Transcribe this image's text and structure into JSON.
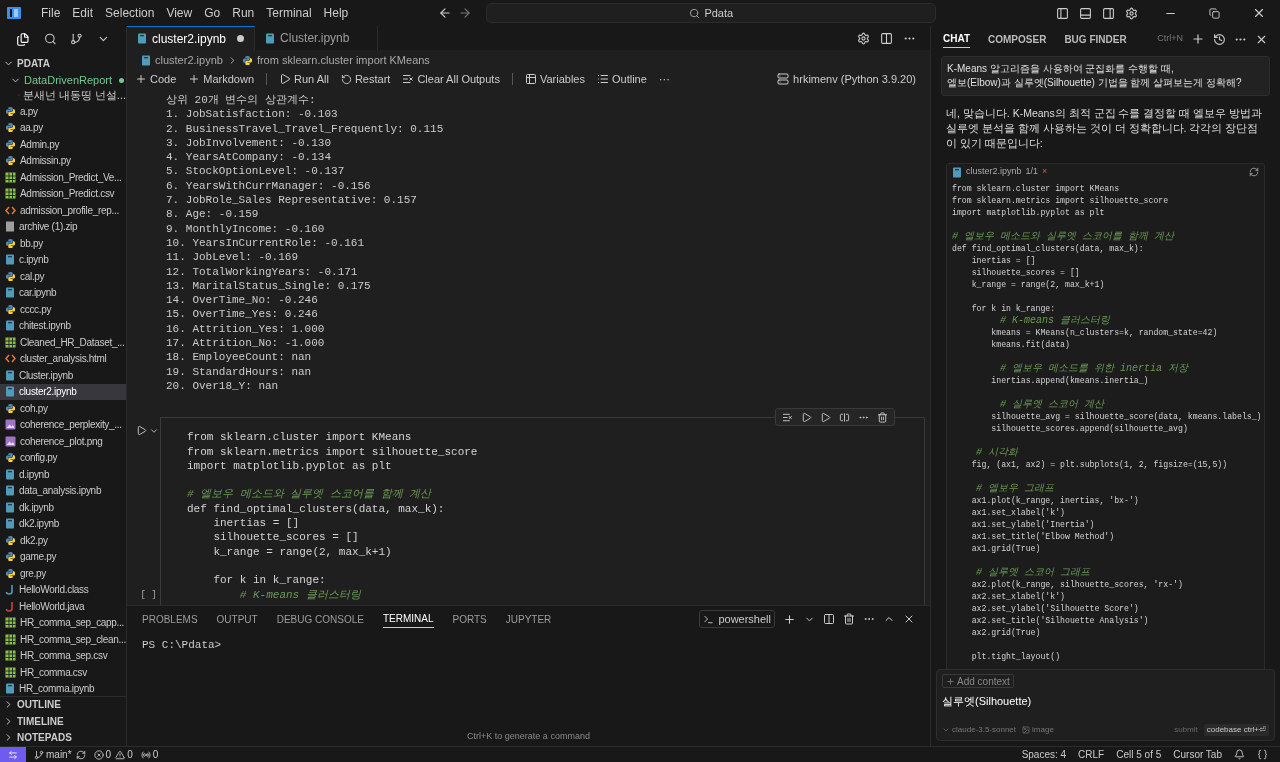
{
  "menu": [
    "File",
    "Edit",
    "Selection",
    "View",
    "Go",
    "Run",
    "Terminal",
    "Help"
  ],
  "search": {
    "value": "Pdata"
  },
  "explorer": {
    "title": "PDATA",
    "folder": {
      "label": "DataDrivenReport",
      "expanded": true,
      "child": "분새넌 내동띵 넌설..."
    },
    "files": [
      {
        "name": "a.py",
        "kind": "py",
        "selected": false
      },
      {
        "name": "aa.py",
        "kind": "py",
        "selected": false
      },
      {
        "name": "Admin.py",
        "kind": "py",
        "selected": false
      },
      {
        "name": "Admissin.py",
        "kind": "py",
        "selected": false
      },
      {
        "name": "Admission_Predict_Ve...",
        "kind": "csv",
        "selected": false
      },
      {
        "name": "Admission_Predict.csv",
        "kind": "csv",
        "selected": false
      },
      {
        "name": "admission_profile_rep...",
        "kind": "html",
        "selected": false
      },
      {
        "name": "archive (1).zip",
        "kind": "zip",
        "selected": false
      },
      {
        "name": "bb.py",
        "kind": "py",
        "selected": false
      },
      {
        "name": "c.ipynb",
        "kind": "ipynb",
        "selected": false
      },
      {
        "name": "cal.py",
        "kind": "py",
        "selected": false
      },
      {
        "name": "car.ipynb",
        "kind": "ipynb",
        "selected": false
      },
      {
        "name": "cccc.py",
        "kind": "py",
        "selected": false
      },
      {
        "name": "chitest.ipynb",
        "kind": "ipynb",
        "selected": false
      },
      {
        "name": "Cleaned_HR_Dataset_...",
        "kind": "csv",
        "selected": false
      },
      {
        "name": "cluster_analysis.html",
        "kind": "html",
        "selected": false
      },
      {
        "name": "Cluster.ipynb",
        "kind": "ipynb",
        "selected": false
      },
      {
        "name": "cluster2.ipynb",
        "kind": "ipynb",
        "selected": true
      },
      {
        "name": "coh.py",
        "kind": "py",
        "selected": false
      },
      {
        "name": "coherence_perplexity_...",
        "kind": "png",
        "selected": false
      },
      {
        "name": "coherence_plot.png",
        "kind": "png",
        "selected": false
      },
      {
        "name": "config.py",
        "kind": "py",
        "selected": false
      },
      {
        "name": "d.ipynb",
        "kind": "ipynb",
        "selected": false
      },
      {
        "name": "data_analysis.ipynb",
        "kind": "ipynb",
        "selected": false
      },
      {
        "name": "dk.ipynb",
        "kind": "ipynb",
        "selected": false
      },
      {
        "name": "dk2.ipynb",
        "kind": "ipynb",
        "selected": false
      },
      {
        "name": "dk2.py",
        "kind": "py",
        "selected": false
      },
      {
        "name": "game.py",
        "kind": "py",
        "selected": false
      },
      {
        "name": "gre.py",
        "kind": "py",
        "selected": false
      },
      {
        "name": "HelloWorld.class",
        "kind": "class",
        "selected": false
      },
      {
        "name": "HelloWorld.java",
        "kind": "java",
        "selected": false
      },
      {
        "name": "HR_comma_sep_capp...",
        "kind": "csv",
        "selected": false
      },
      {
        "name": "HR_comma_sep_clean...",
        "kind": "csv",
        "selected": false
      },
      {
        "name": "HR_comma_sep.csv",
        "kind": "csv",
        "selected": false
      },
      {
        "name": "HR_comma.csv",
        "kind": "csv",
        "selected": false
      },
      {
        "name": "HR_comma.ipynb",
        "kind": "ipynb",
        "selected": false
      }
    ],
    "sections": [
      "OUTLINE",
      "TIMELINE",
      "NOTEPADS"
    ]
  },
  "tabs": [
    {
      "label": "cluster2.ipynb",
      "selected": true,
      "dirty": true
    },
    {
      "label": "Cluster.ipynb",
      "selected": false,
      "dirty": false
    }
  ],
  "breadcrumb": [
    "cluster2.ipynb",
    "from sklearn.cluster import KMeans"
  ],
  "toolbar": {
    "left": [
      "Code",
      "Markdown"
    ],
    "run": [
      "Run All",
      "Restart",
      "Clear All Outputs"
    ],
    "views": [
      "Variables",
      "Outline"
    ],
    "more": "···",
    "kernel": "hrkimenv (Python 3.9.20)"
  },
  "output": [
    "상위 20개 변수의 상관계수:",
    "1. JobSatisfaction: -0.103",
    "2. BusinessTravel_Travel_Frequently: 0.115",
    "3. JobInvolvement: -0.130",
    "4. YearsAtCompany: -0.134",
    "5. StockOptionLevel: -0.137",
    "6. YearsWithCurrManager: -0.156",
    "7. JobRole_Sales Representative: 0.157",
    "8. Age: -0.159",
    "9. MonthlyIncome: -0.160",
    "10. YearsInCurrentRole: -0.161",
    "11. JobLevel: -0.169",
    "12. TotalWorkingYears: -0.171",
    "13. MaritalStatus_Single: 0.175",
    "14. OverTime_No: -0.246",
    "15. OverTime_Yes: 0.246",
    "16. Attrition_Yes: 1.000",
    "17. Attrition_No: -1.000",
    "18. EmployeeCount: nan",
    "19. StandardHours: nan",
    "20. Over18_Y: nan"
  ],
  "cell": {
    "exec": "[ ]",
    "blocks": [
      [
        {
          "text": "from sklearn.cluster import KMeans",
          "kind": "code"
        },
        {
          "text": "from sklearn.metrics import silhouette_score",
          "kind": "code"
        },
        {
          "text": "import matplotlib.pyplot as plt",
          "kind": "code"
        }
      ],
      [
        {
          "text": "# 엘보우 메소드와 실루엣 스코어를 함께 계산",
          "kind": "comment"
        },
        {
          "text": "def find_optimal_clusters(data, max_k):",
          "kind": "code"
        },
        {
          "text": "    inertias = []",
          "kind": "code"
        },
        {
          "text": "    silhouette_scores = []",
          "kind": "code"
        },
        {
          "text": "    k_range = range(2, max_k+1)",
          "kind": "code"
        }
      ],
      [
        {
          "text": "    for k in k_range:",
          "kind": "code"
        },
        {
          "text": "        # K-means 클러스터링",
          "kind": "comment"
        }
      ]
    ]
  },
  "panel": {
    "tabs": [
      {
        "label": "PROBLEMS",
        "selected": false
      },
      {
        "label": "OUTPUT",
        "selected": false
      },
      {
        "label": "DEBUG CONSOLE",
        "selected": false
      },
      {
        "label": "TERMINAL",
        "selected": true
      },
      {
        "label": "PORTS",
        "selected": false
      },
      {
        "label": "JUPYTER",
        "selected": false
      }
    ],
    "shell": "powershell",
    "prompt": "PS C:\\Pdata>",
    "hint": "Ctrl+K to generate a command"
  },
  "chat": {
    "tabs": [
      {
        "label": "CHAT",
        "selected": true
      },
      {
        "label": "COMPOSER",
        "selected": false
      },
      {
        "label": "BUG FINDER",
        "selected": false
      }
    ],
    "shortcut": "Ctrl+N",
    "question": [
      "K-Means 알고리즘을 사용하여 군집화를 수행할 때,",
      "엘보(Elbow)과 실루엣(Silhouette) 기법을 함께 살펴보는게 정확해?"
    ],
    "answer": "네, 맞습니다. K-Means의 최적 군집 수를 결정할 때 엘보우 방법과 실루엣 분석을 함께 사용하는 것이 더 정확합니다. 각각의 장단점이 있기 때문입니다:",
    "code_file": "cluster2.ipynb",
    "code_count": "1/1",
    "code_close": "×",
    "code_blocks": [
      [
        {
          "text": "from sklearn.cluster import KMeans",
          "kind": "code"
        },
        {
          "text": "from sklearn.metrics import silhouette_score",
          "kind": "code"
        },
        {
          "text": "import matplotlib.pyplot as plt",
          "kind": "code"
        }
      ],
      [
        {
          "text": "# 엘보우 메소드와 실루엣 스코어를 함께 계산",
          "kind": "comment"
        },
        {
          "text": "def find_optimal_clusters(data, max_k):",
          "kind": "code"
        },
        {
          "text": "    inertias = []",
          "kind": "code"
        },
        {
          "text": "    silhouette_scores = []",
          "kind": "code"
        },
        {
          "text": "    k_range = range(2, max_k+1)",
          "kind": "code"
        }
      ],
      [
        {
          "text": "    for k in k_range:",
          "kind": "code"
        },
        {
          "text": "        # K-means 클러스터링",
          "kind": "comment"
        },
        {
          "text": "        kmeans = KMeans(n_clusters=k, random_state=42)",
          "kind": "code"
        },
        {
          "text": "        kmeans.fit(data)",
          "kind": "code"
        }
      ],
      [
        {
          "text": "        # 엘보우 메소드를 위한 inertia 저장",
          "kind": "comment"
        },
        {
          "text": "        inertias.append(kmeans.inertia_)",
          "kind": "code"
        }
      ],
      [
        {
          "text": "        # 실루엣 스코어 계산",
          "kind": "comment"
        },
        {
          "text": "        silhouette_avg = silhouette_score(data, kmeans.labels_)",
          "kind": "code"
        },
        {
          "text": "        silhouette_scores.append(silhouette_avg)",
          "kind": "code"
        }
      ],
      [
        {
          "text": "    # 시각화",
          "kind": "comment"
        },
        {
          "text": "    fig, (ax1, ax2) = plt.subplots(1, 2, figsize=(15,5))",
          "kind": "code"
        }
      ],
      [
        {
          "text": "    # 엘보우 그래프",
          "kind": "comment"
        },
        {
          "text": "    ax1.plot(k_range, inertias, 'bx-')",
          "kind": "code"
        },
        {
          "text": "    ax1.set_xlabel('k')",
          "kind": "code"
        },
        {
          "text": "    ax1.set_ylabel('Inertia')",
          "kind": "code"
        },
        {
          "text": "    ax1.set_title('Elbow Method')",
          "kind": "code"
        },
        {
          "text": "    ax1.grid(True)",
          "kind": "code"
        }
      ],
      [
        {
          "text": "    # 실루엣 스코어 그래프",
          "kind": "comment"
        },
        {
          "text": "    ax2.plot(k_range, silhouette_scores, 'rx-')",
          "kind": "code"
        },
        {
          "text": "    ax2.set_xlabel('k')",
          "kind": "code"
        },
        {
          "text": "    ax2.set_ylabel('Silhouette Score')",
          "kind": "code"
        },
        {
          "text": "    ax2.set_title('Silhouette Analysis')",
          "kind": "code"
        },
        {
          "text": "    ax2.grid(True)",
          "kind": "code"
        }
      ],
      [
        {
          "text": "    plt.tight_layout()",
          "kind": "code"
        }
      ]
    ],
    "input": {
      "add_context": "Add context",
      "value": "실루엣(Silhouette)",
      "model": "claude-3.5-sonnet",
      "image": "image",
      "submit": "submit",
      "mode": "codebase ctrl+⏎"
    }
  },
  "status": {
    "branch": "main*",
    "errors": "0",
    "warnings": "0",
    "ports": "0",
    "right": [
      "Spaces: 4",
      "CRLF",
      "Cell 5 of 5",
      "Cursor Tab"
    ]
  }
}
